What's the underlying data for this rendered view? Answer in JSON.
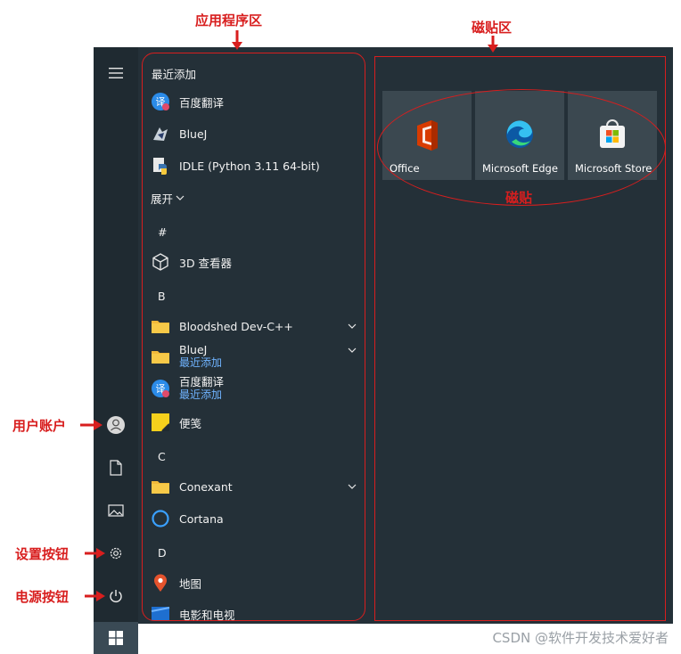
{
  "annotations": {
    "app_area": "应用程序区",
    "tile_area": "磁贴区",
    "tiles": "磁贴",
    "user_account": "用户账户",
    "settings_button": "设置按钮",
    "power_button": "电源按钮"
  },
  "app_list": {
    "recent_header": "最近添加",
    "expand_label": "展开",
    "recent": [
      {
        "label": "百度翻译",
        "icon": "baidu-translate-icon"
      },
      {
        "label": "BlueJ",
        "icon": "bluej-icon"
      },
      {
        "label": "IDLE (Python 3.11 64-bit)",
        "icon": "python-idle-icon"
      }
    ],
    "groups": [
      {
        "letter": "#",
        "items": [
          {
            "label": "3D 查看器",
            "icon": "cube-3d-icon"
          }
        ]
      },
      {
        "letter": "B",
        "items": [
          {
            "label": "Bloodshed Dev-C++",
            "icon": "folder-icon",
            "expandable": true
          },
          {
            "label": "BlueJ",
            "sub": "最近添加",
            "icon": "folder-icon",
            "expandable": true
          },
          {
            "label": "百度翻译",
            "sub": "最近添加",
            "icon": "baidu-translate-icon"
          },
          {
            "label": "便笺",
            "icon": "sticky-notes-icon"
          }
        ]
      },
      {
        "letter": "C",
        "items": [
          {
            "label": "Conexant",
            "icon": "folder-icon",
            "expandable": true
          },
          {
            "label": "Cortana",
            "icon": "cortana-icon"
          }
        ]
      },
      {
        "letter": "D",
        "items": [
          {
            "label": "地图",
            "icon": "maps-icon"
          },
          {
            "label": "电影和电视",
            "icon": "movies-tv-icon"
          }
        ]
      }
    ]
  },
  "tiles": [
    {
      "label": "Office",
      "icon": "office-icon"
    },
    {
      "label": "Microsoft Edge",
      "icon": "edge-icon"
    },
    {
      "label": "Microsoft Store",
      "icon": "store-icon"
    }
  ],
  "watermark": "CSDN @软件开发技术爱好者",
  "colors": {
    "menu_bg": "#243038",
    "rail_bg": "#1f2a31",
    "tile_bg": "#3b4850",
    "annotation_red": "#d81e1e",
    "link_blue": "#6fb3ff"
  }
}
